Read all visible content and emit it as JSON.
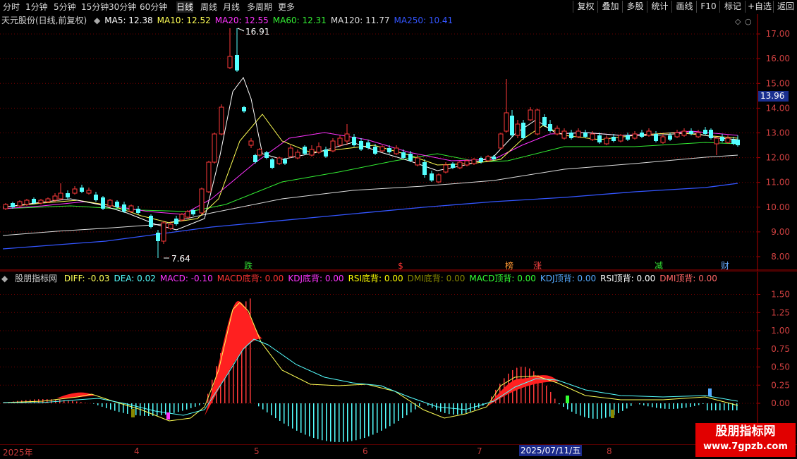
{
  "toolbar": {
    "periods": [
      "分时",
      "1分钟",
      "5分钟",
      "15分钟",
      "30分钟",
      "60分钟",
      "日线",
      "周线",
      "月线",
      "多周期",
      "更多"
    ],
    "active_period": "日线",
    "buttons": [
      "复权",
      "叠加",
      "多股",
      "统计",
      "画线",
      "F10",
      "标记",
      "+自选",
      "返回"
    ]
  },
  "kline": {
    "title": "天元股份(日线,前复权)",
    "ma": [
      {
        "label": "MA5: 12.38",
        "color": "#ffffff"
      },
      {
        "label": "MA10: 12.52",
        "color": "#ffff55"
      },
      {
        "label": "MA20: 12.55",
        "color": "#ff33ff"
      },
      {
        "label": "MA60: 12.31",
        "color": "#33ee33"
      },
      {
        "label": "MA120: 11.77",
        "color": "#dddddd"
      },
      {
        "label": "MA250: 10.41",
        "color": "#3355ff"
      }
    ],
    "y_ticks": [
      "17.00",
      "16.00",
      "15.00",
      "14.00",
      "13.00",
      "12.00",
      "11.00",
      "10.00",
      "9.00",
      "8.00"
    ],
    "current_price": "13.96",
    "high_label": "16.91",
    "low_label": "7.64",
    "events": [
      {
        "text": "跌",
        "color": "#33dd33"
      },
      {
        "text": "$",
        "color": "#ff3333"
      },
      {
        "text": "榜",
        "color": "#ff9933"
      },
      {
        "text": "涨",
        "color": "#ff4444"
      },
      {
        "text": "减",
        "color": "#33dd33"
      },
      {
        "text": "财",
        "color": "#66aaff"
      }
    ]
  },
  "indicator": {
    "title": "股朋指标网",
    "items": [
      {
        "label": "DIFF: -0.03",
        "color": "#ffff55"
      },
      {
        "label": "DEA: 0.02",
        "color": "#55ffff"
      },
      {
        "label": "MACD: -0.10",
        "color": "#ff33ff"
      },
      {
        "label": "MACD底背: 0.00",
        "color": "#ff3333"
      },
      {
        "label": "KDJ底背: 0.00",
        "color": "#ff33ff"
      },
      {
        "label": "RSI底背: 0.00",
        "color": "#ffff00"
      },
      {
        "label": "DMI底背: 0.00",
        "color": "#888800"
      },
      {
        "label": "MACD顶背: 0.00",
        "color": "#33ff33"
      },
      {
        "label": "KDJ顶背: 0.00",
        "color": "#55aaff"
      },
      {
        "label": "RSI顶背: 0.00",
        "color": "#ffffff"
      },
      {
        "label": "DMI顶背: 0.00",
        "color": "#ff6666"
      }
    ],
    "y_ticks": [
      "1.50",
      "1.25",
      "1.00",
      "0.75",
      "0.50",
      "0.25",
      "0.00"
    ]
  },
  "xaxis": {
    "labels": [
      "2025年",
      "4",
      "5",
      "6",
      "7",
      "8"
    ],
    "current_date": "2025/07/11/五"
  },
  "watermark": {
    "line1": "股朋指标网",
    "line2": "www.7gpzb.com"
  }
}
